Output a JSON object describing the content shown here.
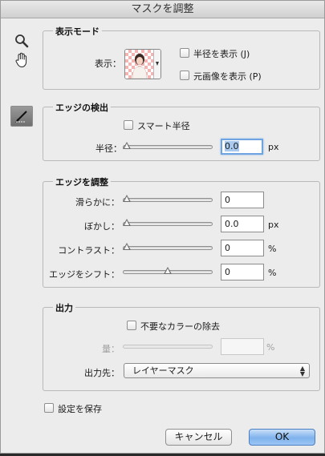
{
  "window": {
    "title": "マスクを調整"
  },
  "tools": [
    "zoom-icon",
    "hand-icon",
    "refine-radius-brush-icon"
  ],
  "view_mode": {
    "title": "表示モード",
    "view_label": "表示：",
    "show_radius_label": "半径を表示 (J)",
    "show_radius_checked": false,
    "show_original_label": "元画像を表示 (P)",
    "show_original_checked": false
  },
  "edge_detection": {
    "title": "エッジの検出",
    "smart_radius_label": "スマート半径",
    "smart_radius_checked": false,
    "radius_label": "半径：",
    "radius_value": "0.0",
    "radius_unit": "px",
    "radius_level": 0
  },
  "adjust_edge": {
    "title": "エッジを調整",
    "rows": [
      {
        "label": "滑らかに：",
        "value": "0",
        "unit": "",
        "level": 0
      },
      {
        "label": "ぼかし：",
        "value": "0.0",
        "unit": "px",
        "level": 0
      },
      {
        "label": "コントラスト：",
        "value": "0",
        "unit": "%",
        "level": 0
      },
      {
        "label": "エッジをシフト：",
        "value": "0",
        "unit": "%",
        "level": 0.5
      }
    ]
  },
  "output": {
    "title": "出力",
    "decontaminate_label": "不要なカラーの除去",
    "decontaminate_checked": false,
    "amount_label": "量：",
    "amount_value": "",
    "amount_unit": "%",
    "output_to_label": "出力先：",
    "output_to_value": "レイヤーマスク"
  },
  "remember_settings_label": "設定を保存",
  "remember_settings_checked": false,
  "buttons": {
    "cancel": "キャンセル",
    "ok": "OK"
  },
  "colors": {
    "ok_button": "#7fb2ec",
    "focus_ring": "#6fa4e0",
    "thumbnail_checker": "#f2b3b3"
  }
}
